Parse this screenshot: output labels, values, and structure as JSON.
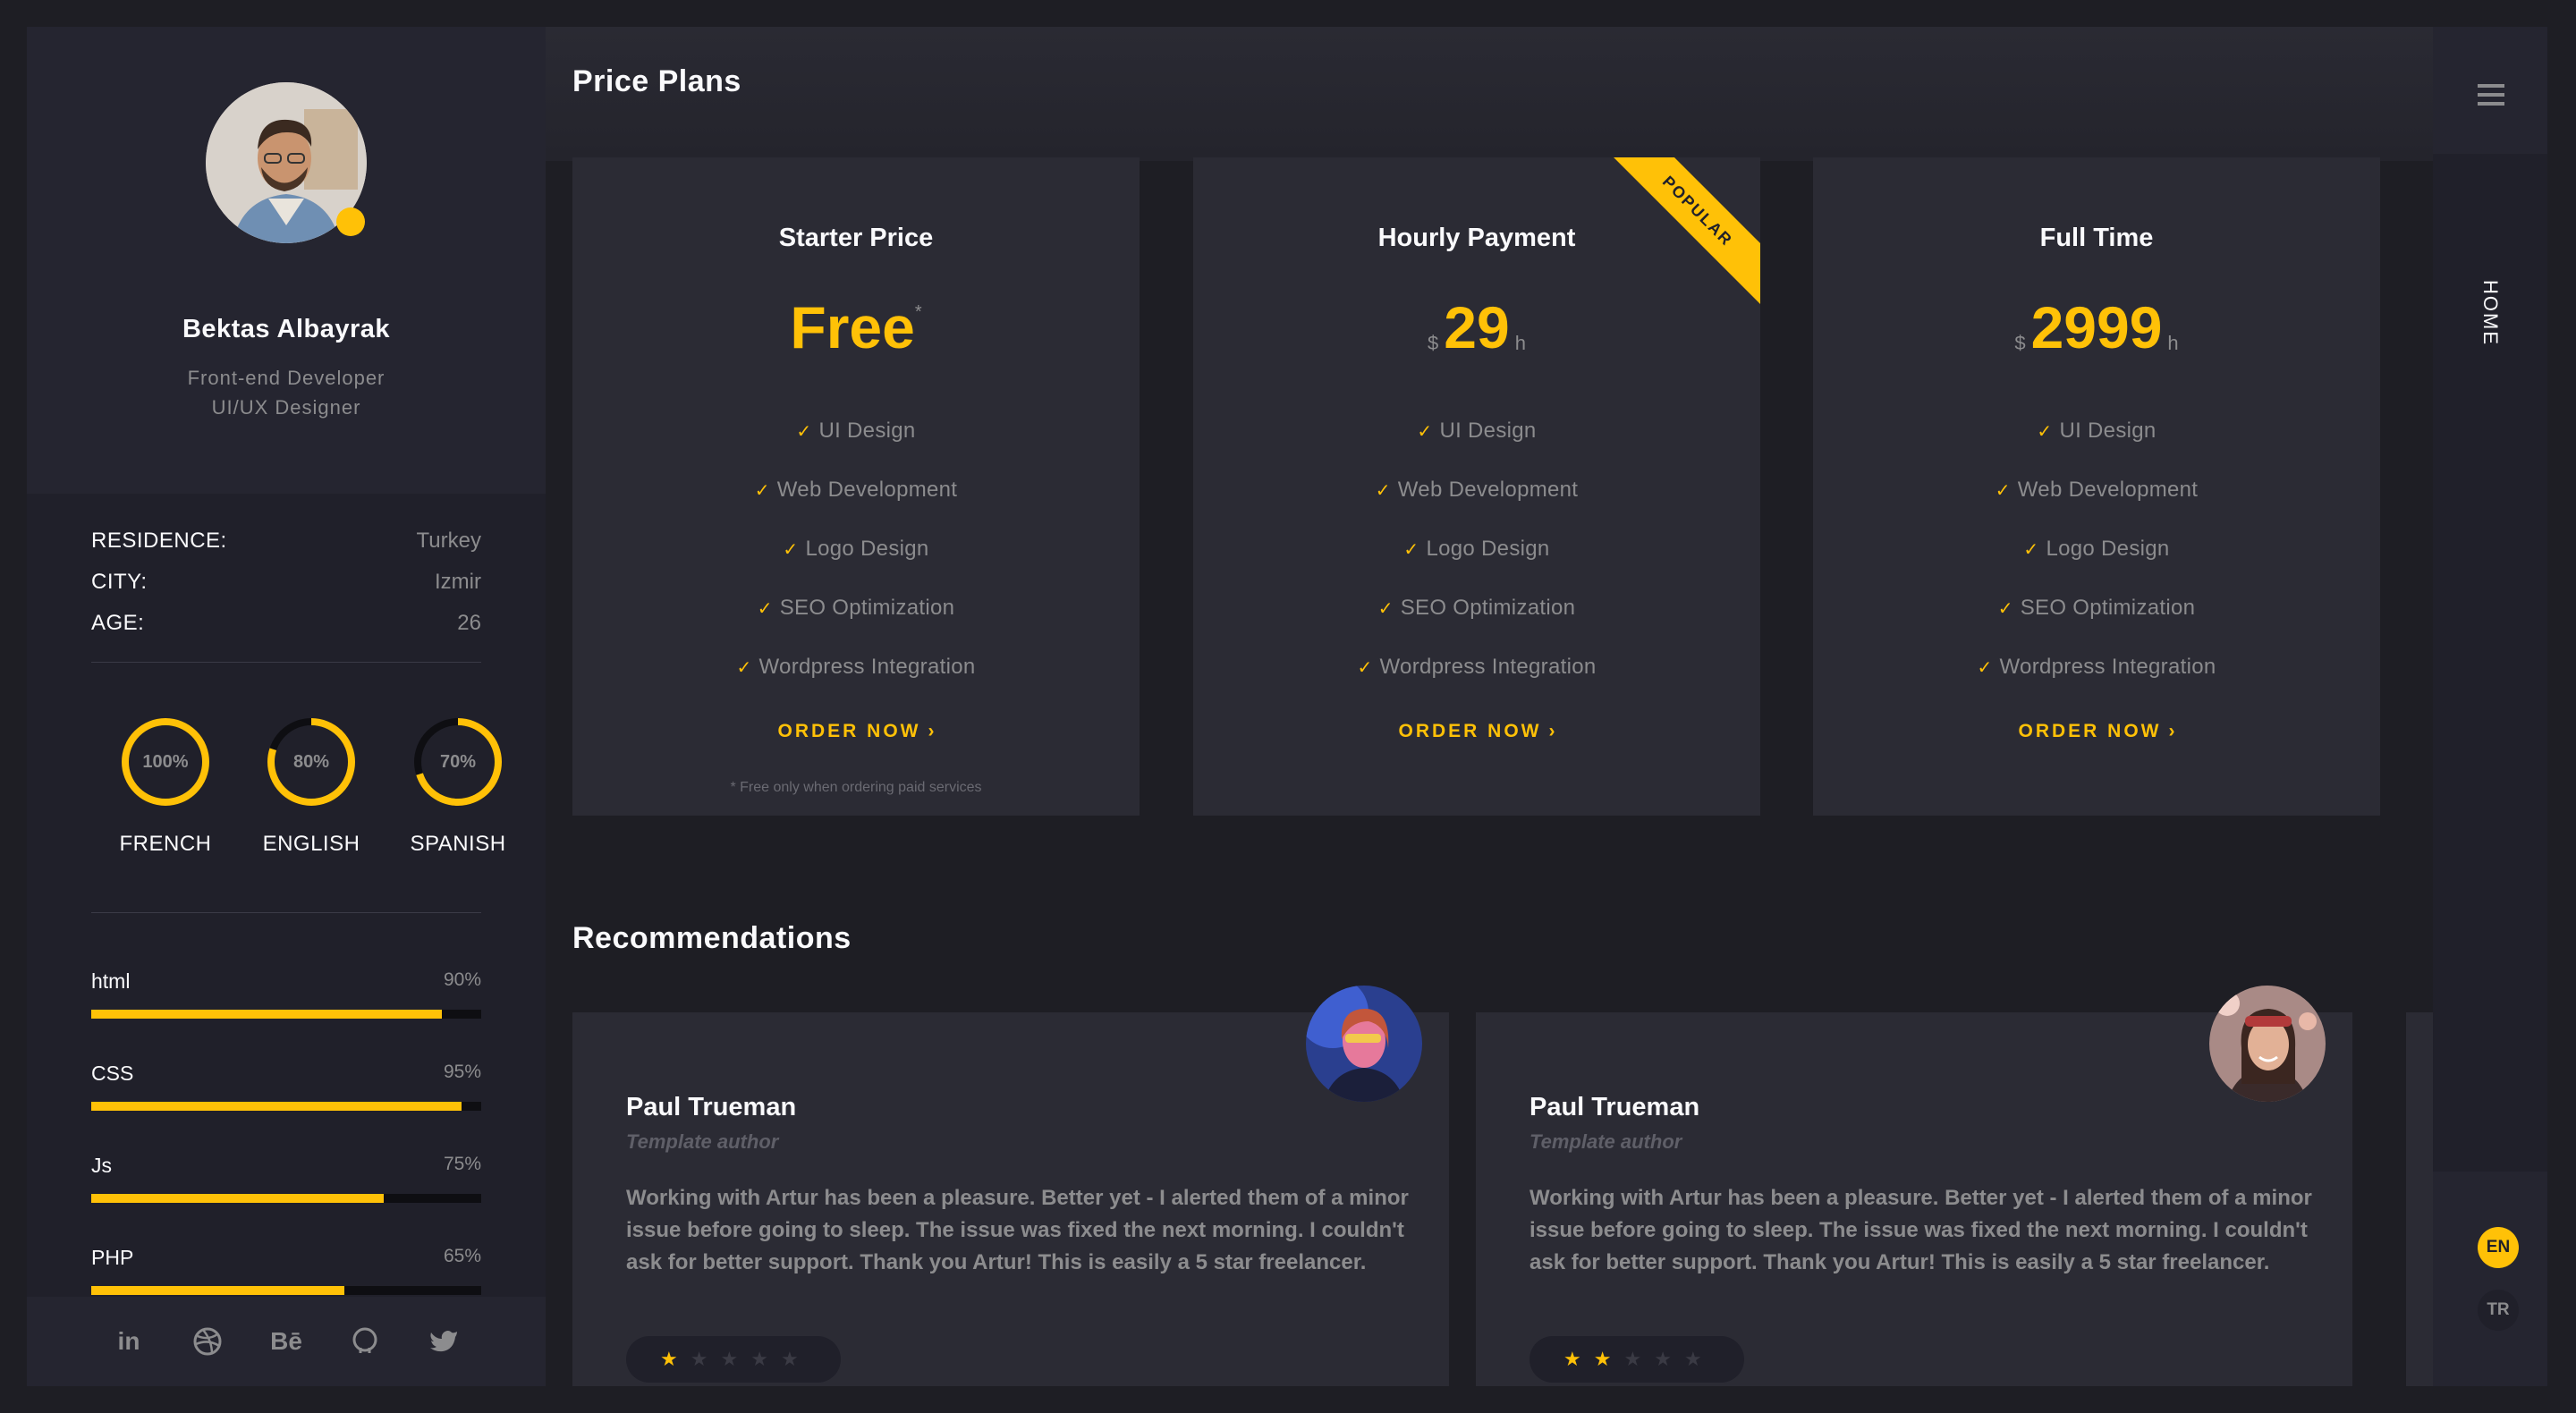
{
  "profile": {
    "name": "Bektas Albayrak",
    "role_line1": "Front-end Developer",
    "role_line2": "UI/UX Designer"
  },
  "info": [
    {
      "key": "RESIDENCE:",
      "value": "Turkey"
    },
    {
      "key": "CITY:",
      "value": "Izmir"
    },
    {
      "key": "AGE:",
      "value": "26"
    }
  ],
  "languages": [
    {
      "label": "100%",
      "name": "FRENCH",
      "percent": 100
    },
    {
      "label": "80%",
      "name": "ENGLISH",
      "percent": 80
    },
    {
      "label": "70%",
      "name": "SPANISH",
      "percent": 70
    }
  ],
  "skills": [
    {
      "name": "html",
      "label": "90%",
      "percent": 90
    },
    {
      "name": "CSS",
      "label": "95%",
      "percent": 95
    },
    {
      "name": "Js",
      "label": "75%",
      "percent": 75
    },
    {
      "name": "PHP",
      "label": "65%",
      "percent": 65
    }
  ],
  "social": [
    {
      "icon": "linkedin-icon",
      "glyph": "in"
    },
    {
      "icon": "dribbble-icon",
      "glyph": ""
    },
    {
      "icon": "behance-icon",
      "glyph": "Bē"
    },
    {
      "icon": "github-icon",
      "glyph": ""
    },
    {
      "icon": "twitter-icon",
      "glyph": ""
    }
  ],
  "pricing": {
    "title": "Price Plans",
    "plans": [
      {
        "title": "Starter Price",
        "price": "Free",
        "asterisk": "*",
        "features": [
          "UI Design",
          "Web Development",
          "Logo Design",
          "SEO Optimization",
          "Wordpress Integration"
        ],
        "order": "ORDER NOW",
        "footnote": "* Free only when ordering paid services"
      },
      {
        "title": "Hourly Payment",
        "currency": "$",
        "price": "29",
        "unit": "h",
        "ribbon": "POPULAR",
        "features": [
          "UI Design",
          "Web Development",
          "Logo Design",
          "SEO Optimization",
          "Wordpress Integration"
        ],
        "order": "ORDER NOW"
      },
      {
        "title": "Full Time",
        "currency": "$",
        "price": "2999",
        "unit": "h",
        "features": [
          "UI Design",
          "Web Development",
          "Logo Design",
          "SEO Optimization",
          "Wordpress Integration"
        ],
        "order": "ORDER NOW"
      }
    ]
  },
  "recommendations": {
    "title": "Recommendations",
    "items": [
      {
        "name": "Paul Trueman",
        "subtitle": "Template author",
        "text": "Working with Artur has been a pleasure. Better yet - I alerted them of a minor issue before going to sleep. The issue was fixed the next morning. I couldn't ask for better support. Thank you Artur! This is easily a 5 star freelancer.",
        "rating": 1,
        "max_rating": 5
      },
      {
        "name": "Paul Trueman",
        "subtitle": "Template author",
        "text": "Working with Artur has been a pleasure. Better yet - I alerted them of a minor issue before going to sleep. The issue was fixed the next morning. I couldn't ask for better support. Thank you Artur! This is easily a 5 star freelancer.",
        "rating": 2,
        "max_rating": 5
      }
    ]
  },
  "menu": {
    "current": "HOME",
    "languages": [
      "EN",
      "TR"
    ],
    "active_language": "EN"
  },
  "colors": {
    "accent": "#ffc107",
    "background": "#1e1e24",
    "card": "#2b2b34",
    "muted_text": "#8c8c8e"
  }
}
